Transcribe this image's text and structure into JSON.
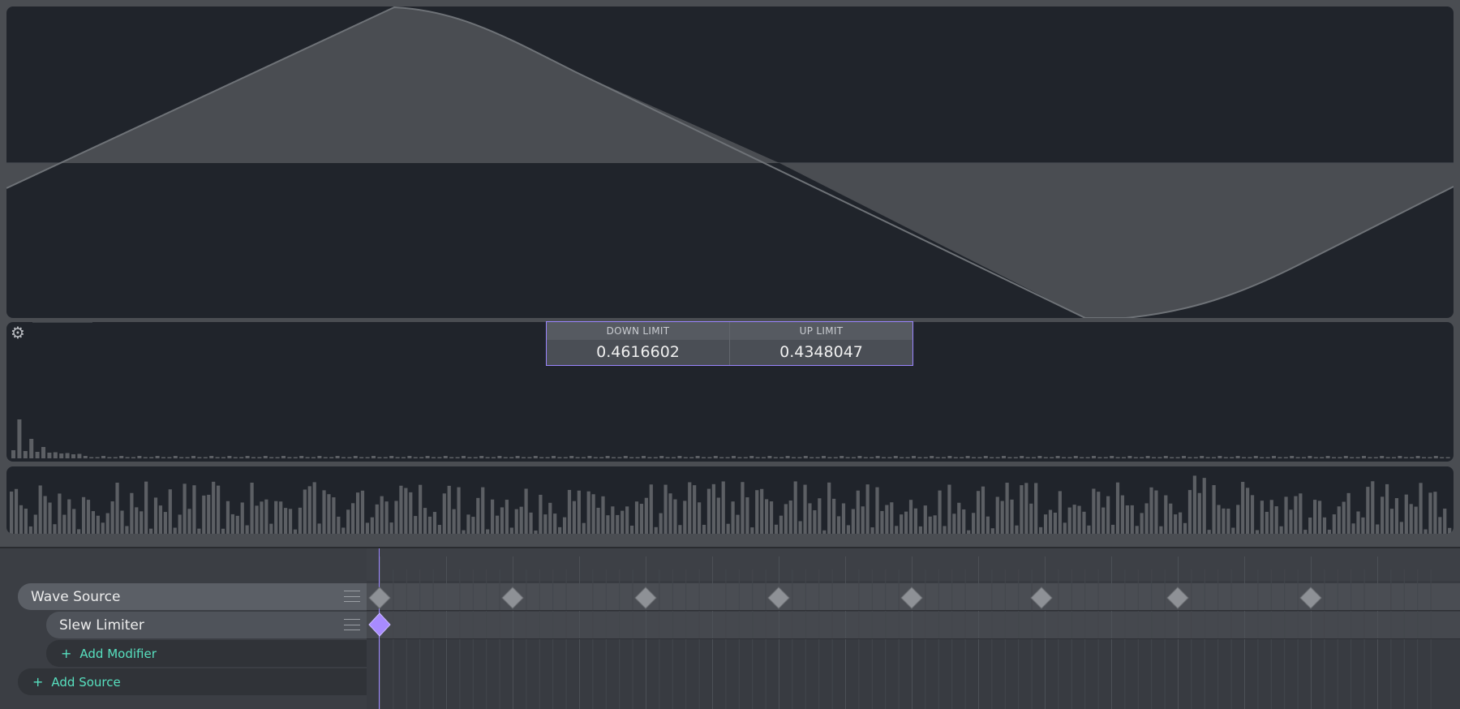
{
  "parameters": {
    "down_limit": {
      "label": "DOWN LIMIT",
      "value": "0.4616602"
    },
    "up_limit": {
      "label": "UP LIMIT",
      "value": "0.4348047"
    }
  },
  "tracks": {
    "source": {
      "label": "Wave Source"
    },
    "modifier": {
      "label": "Slew Limiter"
    },
    "add_modifier": {
      "label": "Add Modifier"
    },
    "add_source": {
      "label": "Add Source"
    }
  },
  "icons": {
    "settings": "gear-icon",
    "track_menu": "menu-icon",
    "add": "plus-icon",
    "keyframe": "diamond-icon"
  },
  "colors": {
    "accent": "#9a85ff",
    "add_text": "#57e0bf",
    "panel": "#20242b",
    "keyframe": "#8e9196"
  }
}
